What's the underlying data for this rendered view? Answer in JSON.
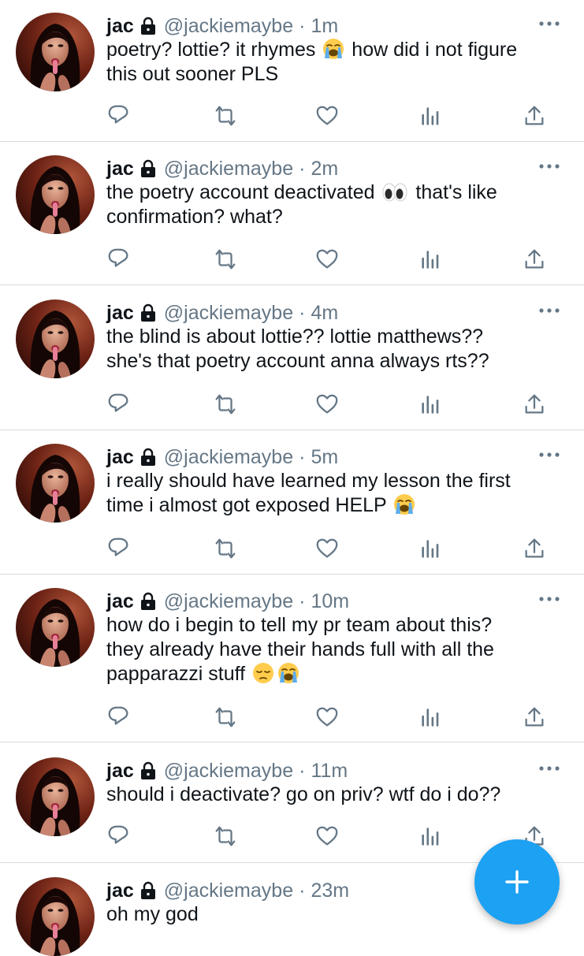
{
  "tweets": [
    {
      "name": "jac",
      "handle": "@jackiemaybe",
      "sep": "·",
      "time": "1m",
      "lines": [
        [
          {
            "t": "poetry? lottie? it rhymes "
          },
          {
            "e": "crying-face-emoji"
          },
          {
            "t": " how did i not figure"
          }
        ],
        [
          {
            "t": "this out sooner PLS"
          }
        ]
      ]
    },
    {
      "name": "jac",
      "handle": "@jackiemaybe",
      "sep": "·",
      "time": "2m",
      "lines": [
        [
          {
            "t": "the poetry account deactivated "
          },
          {
            "e": "eyes-emoji"
          },
          {
            "t": " that's like"
          }
        ],
        [
          {
            "t": "confirmation? what?"
          }
        ]
      ]
    },
    {
      "name": "jac",
      "handle": "@jackiemaybe",
      "sep": "·",
      "time": "4m",
      "lines": [
        [
          {
            "t": "the blind is about lottie?? lottie matthews??"
          }
        ],
        [
          {
            "t": "she's that poetry account anna always rts??"
          }
        ]
      ]
    },
    {
      "name": "jac",
      "handle": "@jackiemaybe",
      "sep": "·",
      "time": "5m",
      "lines": [
        [
          {
            "t": "i really should have learned my lesson the first"
          }
        ],
        [
          {
            "t": "time i almost got exposed HELP "
          },
          {
            "e": "crying-face-emoji"
          }
        ]
      ]
    },
    {
      "name": "jac",
      "handle": "@jackiemaybe",
      "sep": "·",
      "time": "10m",
      "lines": [
        [
          {
            "t": "how do i begin to tell my pr team about this?"
          }
        ],
        [
          {
            "t": "they already have their hands full with all the"
          }
        ],
        [
          {
            "t": "papparazzi stuff "
          },
          {
            "e": "pensive-face-emoji"
          },
          {
            "e": "crying-face-emoji"
          }
        ]
      ]
    },
    {
      "name": "jac",
      "handle": "@jackiemaybe",
      "sep": "·",
      "time": "11m",
      "lines": [
        [
          {
            "t": "should i deactivate? go on priv? wtf do i do??"
          }
        ]
      ]
    },
    {
      "name": "jac",
      "handle": "@jackiemaybe",
      "sep": "·",
      "time": "23m",
      "lines": [
        [
          {
            "t": "oh my god"
          }
        ]
      ]
    }
  ],
  "icons": {
    "lock": "lock-icon",
    "more": "more-dots-icon",
    "reply": "reply-icon",
    "retweet": "retweet-icon",
    "like": "heart-icon",
    "analytics": "analytics-icon",
    "share": "share-icon",
    "compose": "compose-plus-icon"
  },
  "colors": {
    "accent": "#1da1f2",
    "icon": "#657786",
    "text": "#0f1419",
    "divider": "#d6dbdf"
  }
}
